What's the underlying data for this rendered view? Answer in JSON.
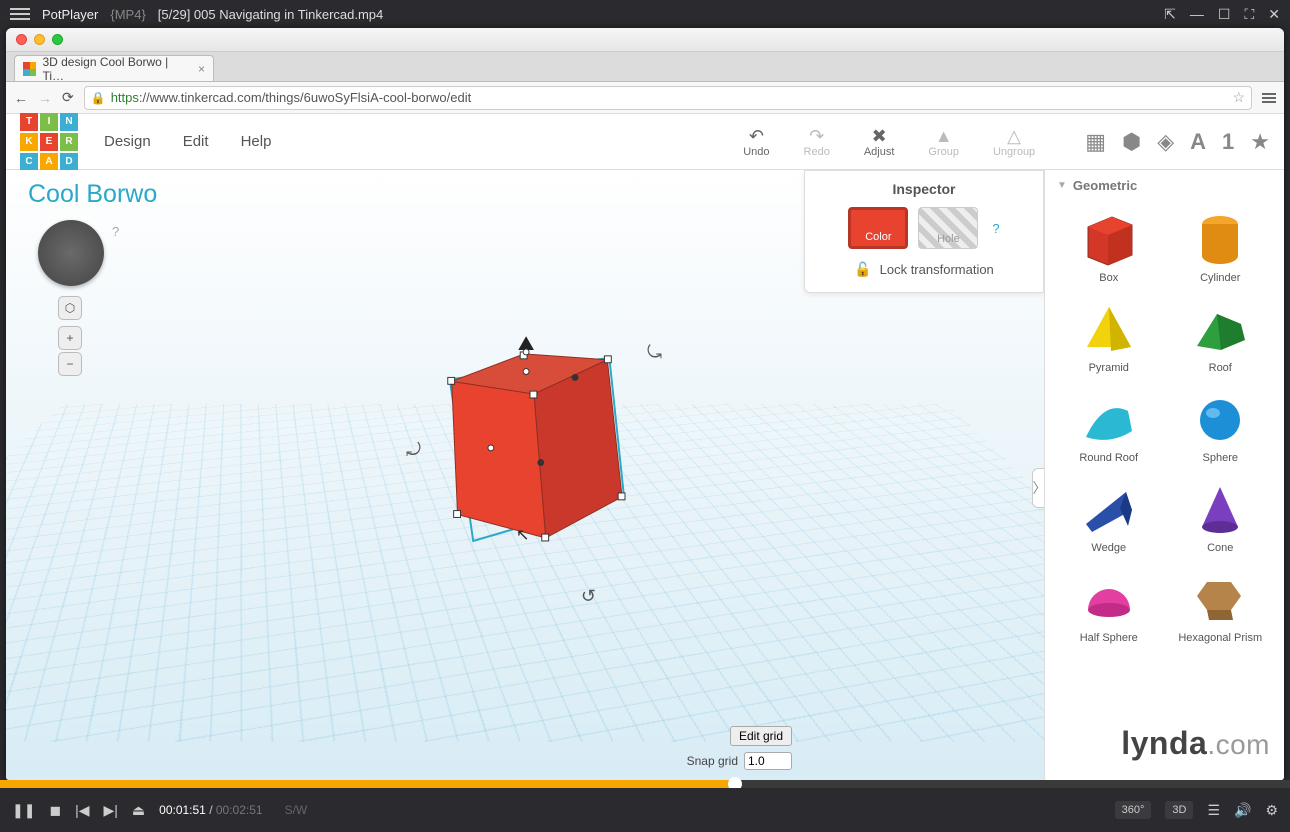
{
  "player": {
    "app_name": "PotPlayer",
    "format": "{MP4}",
    "file": "[5/29] 005 Navigating in Tinkercad.mp4",
    "time_current": "00:01:51",
    "time_total": "00:02:51",
    "dim_label": "S/W",
    "badge_360": "360°",
    "badge_3d": "3D"
  },
  "browser": {
    "tab_title": "3D design Cool Borwo | Ti…",
    "url_scheme": "https",
    "url_rest": "://www.tinkercad.com/things/6uwoSyFlsiA-cool-borwo/edit"
  },
  "tinkercad": {
    "menu": {
      "design": "Design",
      "edit": "Edit",
      "help": "Help"
    },
    "tools": {
      "undo": "Undo",
      "redo": "Redo",
      "adjust": "Adjust",
      "group": "Group",
      "ungroup": "Ungroup"
    },
    "project_name": "Cool Borwo",
    "inspector": {
      "title": "Inspector",
      "color": "Color",
      "hole": "Hole",
      "help": "?",
      "lock": "Lock transformation"
    },
    "grid": {
      "edit": "Edit grid",
      "snap_label": "Snap grid",
      "snap_value": "1.0"
    },
    "shapes_category": "Geometric",
    "shapes": [
      {
        "label": "Box"
      },
      {
        "label": "Cylinder"
      },
      {
        "label": "Pyramid"
      },
      {
        "label": "Roof"
      },
      {
        "label": "Round Roof"
      },
      {
        "label": "Sphere"
      },
      {
        "label": "Wedge"
      },
      {
        "label": "Cone"
      },
      {
        "label": "Half Sphere"
      },
      {
        "label": "Hexagonal Prism"
      }
    ],
    "watermark": {
      "brand": "lynda",
      "suffix": ".com"
    }
  }
}
